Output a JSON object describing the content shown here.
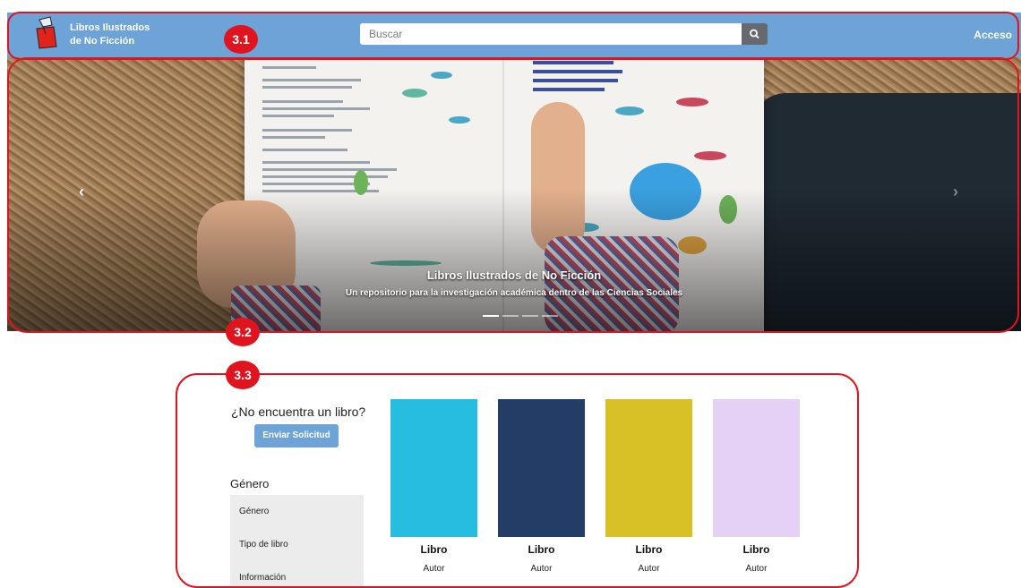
{
  "header": {
    "brand_line1": "Libros Ilustrados",
    "brand_line2": "de No Ficción",
    "search_placeholder": "Buscar",
    "login_label": "Acceso",
    "logo_icon": "red-box-book-logo-icon",
    "search_icon": "magnifier-icon"
  },
  "hero": {
    "title": "Libros Ilustrados de No Ficción",
    "subtitle": "Un repositorio para la investigación académica dentro de las Ciencias Sociales",
    "prev_icon": "chevron-left-icon",
    "next_icon": "chevron-right-icon",
    "slides": 4,
    "active_slide": 1
  },
  "request": {
    "prompt": "¿No encuentra un libro?",
    "button_label": "Enviar Solicitud"
  },
  "genre": {
    "heading": "Género",
    "items": [
      "Género",
      "Tipo de libro",
      "Información"
    ]
  },
  "books": [
    {
      "title": "Libro",
      "author": "Autor",
      "color": "#26bde0"
    },
    {
      "title": "Libro",
      "author": "Autor",
      "color": "#243d66"
    },
    {
      "title": "Libro",
      "author": "Autor",
      "color": "#d8c126"
    },
    {
      "title": "Libro",
      "author": "Autor",
      "color": "#e5d1f5"
    }
  ],
  "annotations": {
    "labels": [
      "3.1",
      "3.2",
      "3.3"
    ],
    "color": "#e0141e"
  },
  "colors": {
    "navbar": "#6ea3d8",
    "search_button": "#666a70",
    "sidebar_bg": "#ececec"
  }
}
